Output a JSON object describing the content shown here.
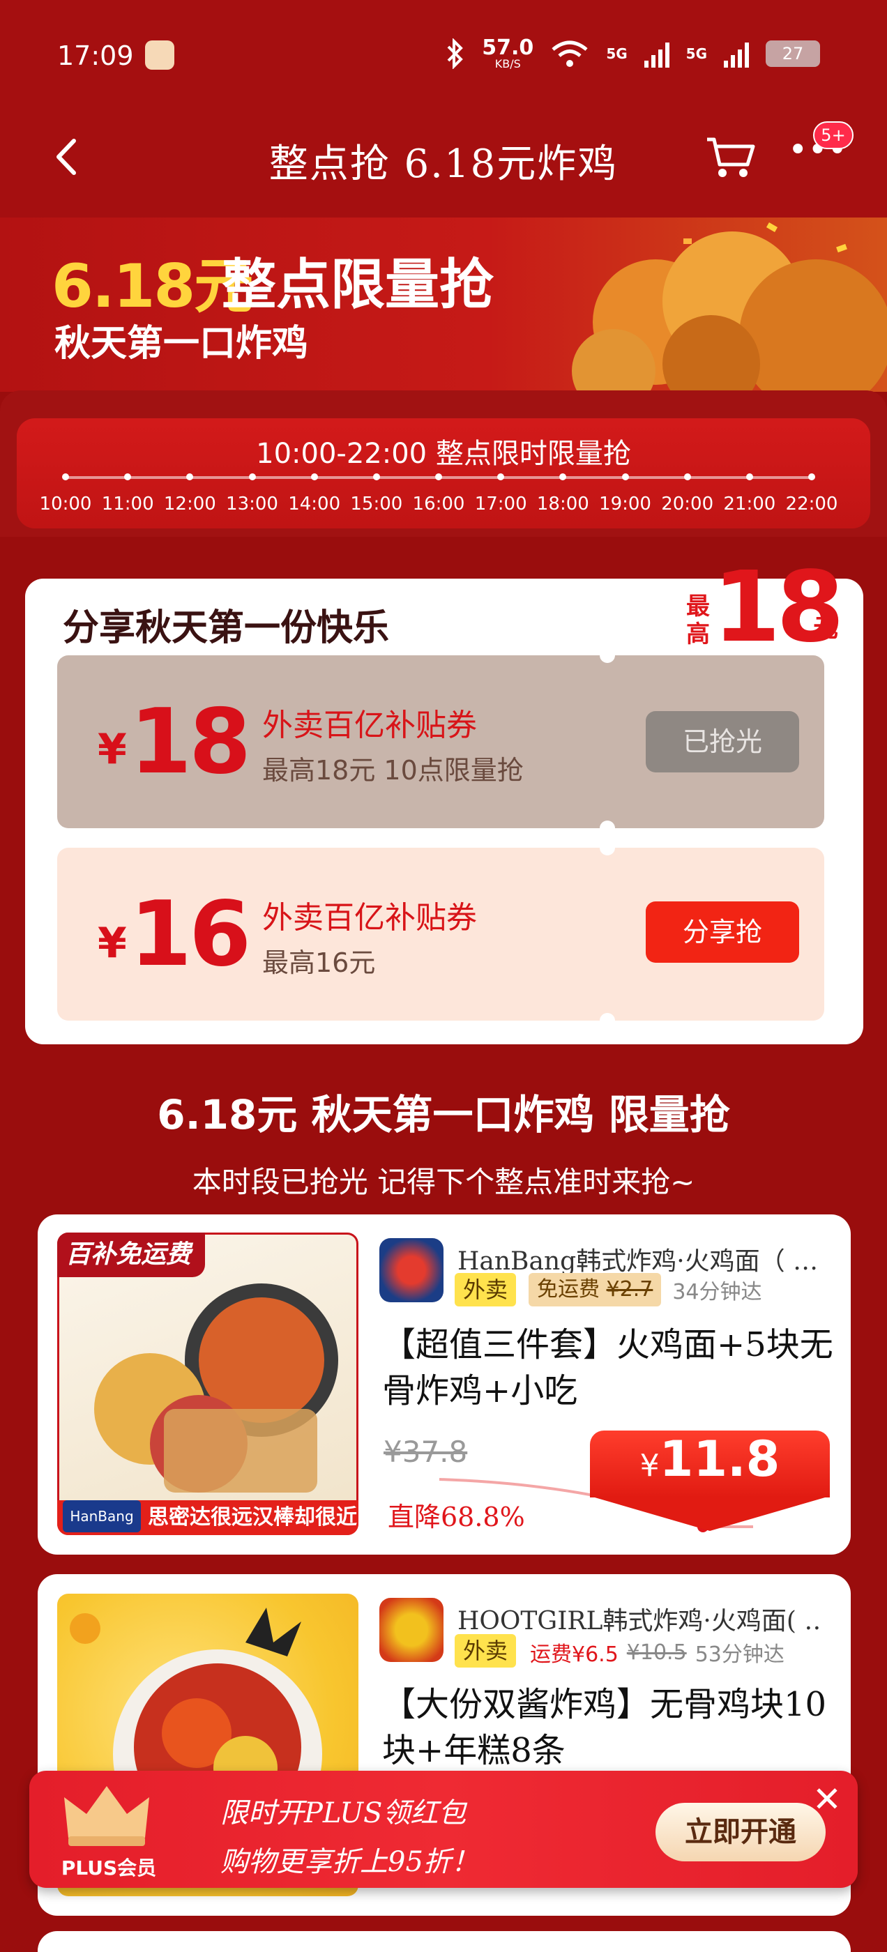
{
  "status_bar": {
    "time": "17:09",
    "net_speed_value": "57.0",
    "net_speed_unit": "KB/S",
    "signal1_label": "5G",
    "signal2_label": "5G",
    "battery": "27",
    "icons": [
      "bluetooth-icon",
      "wifi-icon",
      "signal-icon",
      "battery-icon"
    ]
  },
  "nav": {
    "title": "整点抢 6.18元炸鸡",
    "badge": "5+"
  },
  "hero": {
    "price": "6.18元",
    "headline": "整点限量抢",
    "subline": "秋天第一口炸鸡"
  },
  "timeline": {
    "title": "10:00-22:00 整点限时限量抢",
    "hours": [
      "10:00",
      "11:00",
      "12:00",
      "13:00",
      "14:00",
      "15:00",
      "16:00",
      "17:00",
      "18:00",
      "19:00",
      "20:00",
      "21:00",
      "22:00"
    ]
  },
  "coupon_section": {
    "heading": "分享秋天第一份快乐",
    "max_label": "最高",
    "max_amount": "18",
    "max_unit": "元",
    "coupons": [
      {
        "yen": "¥",
        "amount": "18",
        "title": "外卖百亿补贴券",
        "desc": "最高18元 10点限量抢",
        "button": "已抢光"
      },
      {
        "yen": "¥",
        "amount": "16",
        "title": "外卖百亿补贴券",
        "desc": "最高16元",
        "button": "分享抢"
      }
    ]
  },
  "section": {
    "title": "6.18元 秋天第一口炸鸡 限量抢",
    "subtitle": "本时段已抢光 记得下个整点准时来抢~"
  },
  "products": [
    {
      "image_tag": "百补免运费",
      "image_footer": "思密达很远汉棒却很近",
      "image_brand": "HanBang",
      "shop": "HanBang韩式炸鸡·火鸡面（ …",
      "channel": "外卖",
      "fee_label": "免运费",
      "fee_orig": "¥2.7",
      "eta": "34分钟达",
      "title": "【超值三件套】火鸡面+5块无骨炸鸡+小吃",
      "orig_price": "¥37.8",
      "drop_rate": "直降68.8%",
      "price_yen": "¥",
      "price": "11.8"
    },
    {
      "shop": "HOOTGIRL韩式炸鸡·火鸡面( …",
      "channel": "外卖",
      "fee_label": "运费¥6.5",
      "fee_orig": "¥10.5",
      "eta": "53分钟达",
      "title": "【大份双酱炸鸡】无骨鸡块10块+年糕8条"
    }
  ],
  "plus_banner": {
    "label": "PLUS会员",
    "line1": "限时开PLUS领红包",
    "line2": "购物更享折上95折！",
    "button": "立即开通"
  },
  "colors": {
    "page_bg": "#9a0d0d",
    "accent_red": "#e0161b",
    "gold": "#ffd43d"
  }
}
